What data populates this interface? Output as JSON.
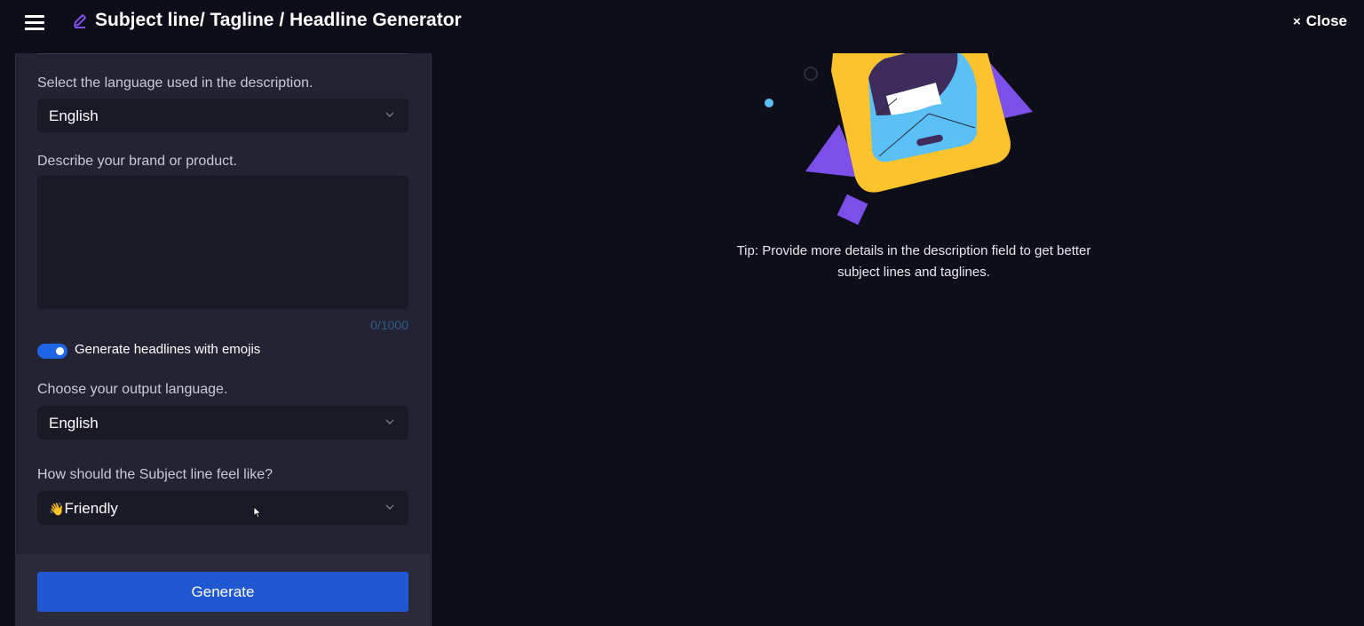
{
  "header": {
    "title": "Subject line/ Tagline / Headline Generator",
    "close_label": "Close",
    "close_glyph": "×",
    "menu_icon": "hamburger-icon",
    "title_icon": "pencil-icon",
    "accent_color": "#7b4fe8"
  },
  "form": {
    "description_language": {
      "label": "Select the language used in the description.",
      "value": "English"
    },
    "description": {
      "label": "Describe your brand or product.",
      "value": "",
      "counter": "0/1000"
    },
    "emoji_toggle": {
      "label": "Generate headlines with emojis",
      "checked": true,
      "color": "#1f66e6"
    },
    "output_language": {
      "label": "Choose your output language.",
      "value": "English"
    },
    "tone": {
      "label": "How should the Subject line feel like?",
      "emoji": "👋",
      "value": "Friendly"
    },
    "generate_label": "Generate",
    "generate_color": "#2058d4"
  },
  "tip": {
    "text": "Tip: Provide more details in the description field to get better subject lines and taglines."
  }
}
